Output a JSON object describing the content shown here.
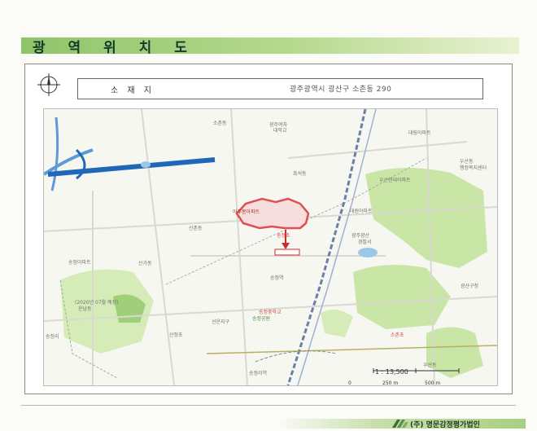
{
  "header": {
    "title": "광 역 위 치 도"
  },
  "info": {
    "label": "소 재 지",
    "address": "광주광역시 광산구 소촌동 290"
  },
  "map": {
    "subject_label": "아주봉아파트",
    "labels": [
      {
        "id": "l1",
        "text": "광주여자",
        "color": "gray"
      },
      {
        "id": "l2",
        "text": "대학교",
        "color": "gray"
      },
      {
        "id": "l3",
        "text": "소촌동",
        "color": "gray"
      },
      {
        "id": "l4",
        "text": "흑석동",
        "color": "gray"
      },
      {
        "id": "l5",
        "text": "우산동",
        "color": "gray"
      },
      {
        "id": "l6",
        "text": "행정복지센터",
        "color": "gray"
      },
      {
        "id": "l7",
        "text": "우산현대아파트",
        "color": "gray"
      },
      {
        "id": "l8",
        "text": "대림아파트",
        "color": "gray"
      },
      {
        "id": "l9",
        "text": "광주광산",
        "color": "gray"
      },
      {
        "id": "l10",
        "text": "경찰서",
        "color": "gray"
      },
      {
        "id": "l11",
        "text": "대원아파트",
        "color": "gray"
      },
      {
        "id": "l12",
        "text": "송정초",
        "color": "red"
      },
      {
        "id": "l13",
        "text": "송정중학교",
        "color": "red"
      },
      {
        "id": "l14",
        "text": "송정역",
        "color": "gray"
      },
      {
        "id": "l15",
        "text": "송정공원",
        "color": "green"
      },
      {
        "id": "l16",
        "text": "신촌동",
        "color": "gray"
      },
      {
        "id": "l17",
        "text": "송정리역",
        "color": "gray"
      },
      {
        "id": "l18",
        "text": "우산동",
        "color": "gray"
      },
      {
        "id": "l19",
        "text": "광산구청",
        "color": "gray"
      },
      {
        "id": "l20",
        "text": "송정아파트",
        "color": "gray"
      },
      {
        "id": "l21",
        "text": "신가동",
        "color": "gray"
      },
      {
        "id": "l22",
        "text": "(2020년 07월 예정)",
        "color": "gray"
      },
      {
        "id": "l23",
        "text": "운남동",
        "color": "gray"
      },
      {
        "id": "l24",
        "text": "송정리",
        "color": "gray"
      },
      {
        "id": "l25",
        "text": "선운지구",
        "color": "gray"
      },
      {
        "id": "l26",
        "text": "산정초",
        "color": "red"
      },
      {
        "id": "l27",
        "text": "소촌초",
        "color": "red"
      }
    ],
    "scale_text": "1 : 13,500",
    "scale_ticks": [
      "0",
      "250 m",
      "500 m"
    ]
  },
  "footer": {
    "company": "(주) 명문감정평가법인"
  },
  "colors": {
    "header_green": "#8fc46a",
    "subject_red": "#e05050",
    "highway_blue": "#1f68b8",
    "park_green": "#c9e6a6"
  }
}
